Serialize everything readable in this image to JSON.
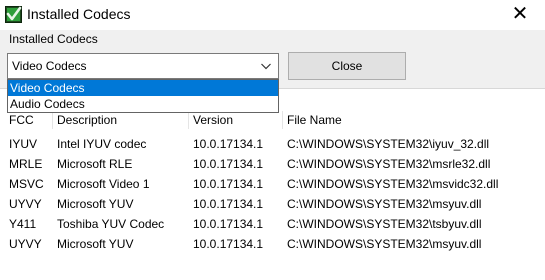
{
  "window": {
    "title": "Installed Codecs",
    "close_glyph": "✕"
  },
  "group": {
    "label": "Installed Codecs"
  },
  "combo": {
    "value": "Video Codecs",
    "options": [
      "Video Codecs",
      "Audio Codecs"
    ],
    "selected_option": "Video Codecs"
  },
  "buttons": {
    "close_label": "Close"
  },
  "list": {
    "columns": [
      "FCC",
      "Description",
      "Version",
      "File Name"
    ],
    "rows": [
      [
        "IYUV",
        "Intel IYUV codec",
        "10.0.17134.1",
        "C:\\WINDOWS\\SYSTEM32\\iyuv_32.dll"
      ],
      [
        "MRLE",
        "Microsoft RLE",
        "10.0.17134.1",
        "C:\\WINDOWS\\SYSTEM32\\msrle32.dll"
      ],
      [
        "MSVC",
        "Microsoft Video 1",
        "10.0.17134.1",
        "C:\\WINDOWS\\SYSTEM32\\msvidc32.dll"
      ],
      [
        "UYVY",
        "Microsoft YUV",
        "10.0.17134.1",
        "C:\\WINDOWS\\SYSTEM32\\msyuv.dll"
      ],
      [
        "Y411",
        "Toshiba YUV Codec",
        "10.0.17134.1",
        "C:\\WINDOWS\\SYSTEM32\\tsbyuv.dll"
      ],
      [
        "UYVY",
        "Microsoft YUV",
        "10.0.17134.1",
        "C:\\WINDOWS\\SYSTEM32\\msyuv.dll"
      ]
    ]
  },
  "colors": {
    "selection": "#0078d7",
    "icon_green": "#2e9e3a",
    "icon_dark": "#1e4a1e",
    "dialog_bg": "#f0f0f0"
  },
  "icons": {
    "app": "checkmark-codec-icon",
    "combo_arrow": "chevron-down-icon"
  }
}
